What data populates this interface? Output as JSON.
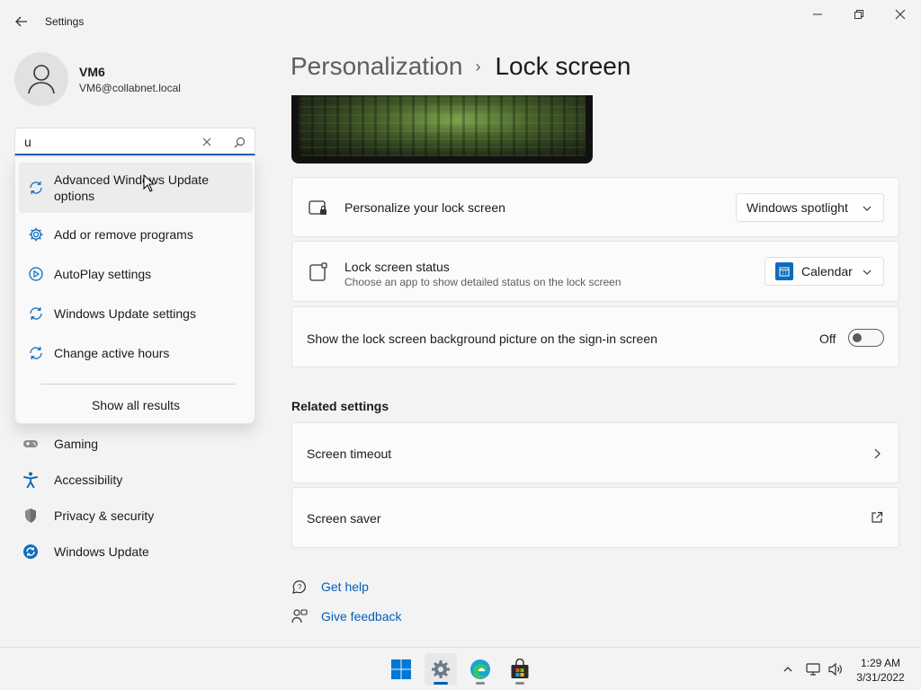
{
  "window": {
    "title": "Settings"
  },
  "user": {
    "name": "VM6",
    "email": "VM6@collabnet.local"
  },
  "search": {
    "value": "u",
    "suggestions": [
      {
        "label": "Advanced Windows Update options",
        "icon": "update-icon"
      },
      {
        "label": "Add or remove programs",
        "icon": "gear-icon"
      },
      {
        "label": "AutoPlay settings",
        "icon": "autoplay-icon"
      },
      {
        "label": "Windows Update settings",
        "icon": "update-icon"
      },
      {
        "label": "Change active hours",
        "icon": "update-icon"
      }
    ],
    "show_all": "Show all results"
  },
  "nav": {
    "items": [
      {
        "label": "Gaming",
        "icon": "gamepad-icon"
      },
      {
        "label": "Accessibility",
        "icon": "accessibility-icon"
      },
      {
        "label": "Privacy & security",
        "icon": "shield-icon"
      },
      {
        "label": "Windows Update",
        "icon": "update-icon"
      }
    ]
  },
  "header": {
    "parent": "Personalization",
    "separator": "›",
    "current": "Lock screen"
  },
  "settings": {
    "personalize": {
      "title": "Personalize your lock screen",
      "value": "Windows spotlight"
    },
    "status": {
      "title": "Lock screen status",
      "subtitle": "Choose an app to show detailed status on the lock screen",
      "value": "Calendar"
    },
    "signin_bg": {
      "title": "Show the lock screen background picture on the sign-in screen",
      "state_label": "Off",
      "on": false
    }
  },
  "related": {
    "title": "Related settings",
    "items": [
      {
        "label": "Screen timeout",
        "icon": "chevron-right-icon"
      },
      {
        "label": "Screen saver",
        "icon": "open-external-icon"
      }
    ]
  },
  "help": {
    "get_help": "Get help",
    "feedback": "Give feedback"
  },
  "taskbar": {
    "apps": [
      "start",
      "settings",
      "edge",
      "store"
    ],
    "time": "1:29 AM",
    "date": "3/31/2022"
  },
  "colors": {
    "accent": "#005fb8",
    "background": "#f3f3f3",
    "card": "#fbfbfb"
  }
}
